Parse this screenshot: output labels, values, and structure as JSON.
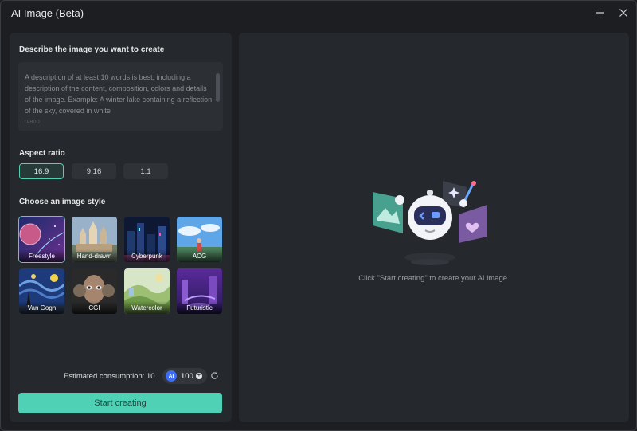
{
  "window": {
    "title": "AI Image (Beta)"
  },
  "prompt": {
    "label": "Describe the image you want to create",
    "placeholder": "A description of at least 10 words is best, including a description of the content, composition, colors and details of the image. Example: A winter lake containing a reflection of the sky, covered in white",
    "count": "0/800"
  },
  "aspect": {
    "label": "Aspect ratio",
    "options": [
      "16:9",
      "9:16",
      "1:1"
    ],
    "selected": "16:9"
  },
  "style": {
    "label": "Choose an image style",
    "options": [
      "Freestyle",
      "Hand-drawn",
      "Cyberpunk",
      "ACG",
      "Van Gogh",
      "CGI",
      "Watercolor",
      "Futuristic"
    ],
    "selected": "Freestyle"
  },
  "footer": {
    "consumption": "Estimated consumption: 10",
    "ai_badge": "AI",
    "credits": "100",
    "start_label": "Start creating"
  },
  "preview": {
    "hint": "Click \"Start creating\" to create your AI image."
  },
  "colors": {
    "accent": "#4fd1b6",
    "panel": "#25282c",
    "background": "#1c1e21"
  },
  "icons": [
    "minimize-icon",
    "close-icon",
    "refresh-icon",
    "plus-icon",
    "robot-icon",
    "image-card-icon",
    "sparkle-icon",
    "heart-card-icon"
  ]
}
